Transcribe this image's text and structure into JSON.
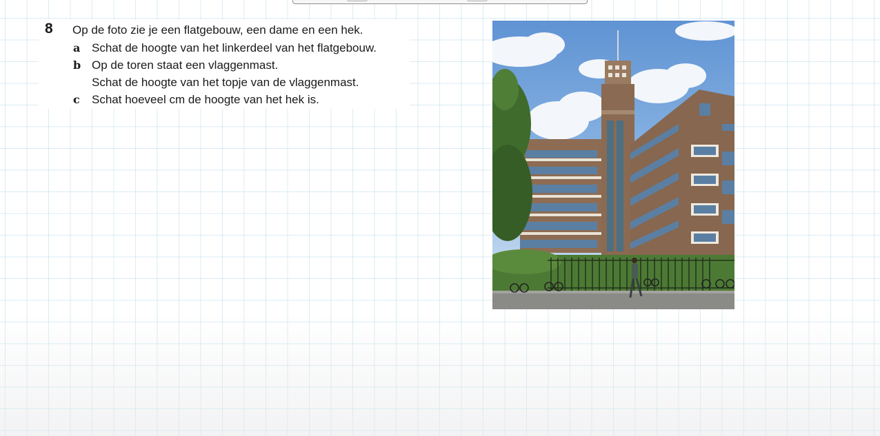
{
  "exercise": {
    "number": "8",
    "intro": "Op de foto zie je een flatgebouw, een dame en een hek.",
    "questions": [
      {
        "letter": "a",
        "lines": [
          "Schat de hoogte van het linkerdeel van het flatgebouw."
        ]
      },
      {
        "letter": "b",
        "lines": [
          "Op de toren staat een vlaggenmast.",
          "Schat de hoogte van het topje van de vlaggenmast."
        ]
      },
      {
        "letter": "c",
        "lines": [
          "Schat hoeveel cm de hoogte van het hek is."
        ]
      }
    ]
  },
  "photo": {
    "subject": "flatgebouw-met-toren",
    "colors": {
      "sky": "#6f9fd8",
      "brick": "#8a6a52",
      "glass": "#5b7fa3",
      "trees": "#3f6b2c",
      "fence": "#2b3a22",
      "street": "#8a8a86"
    }
  }
}
